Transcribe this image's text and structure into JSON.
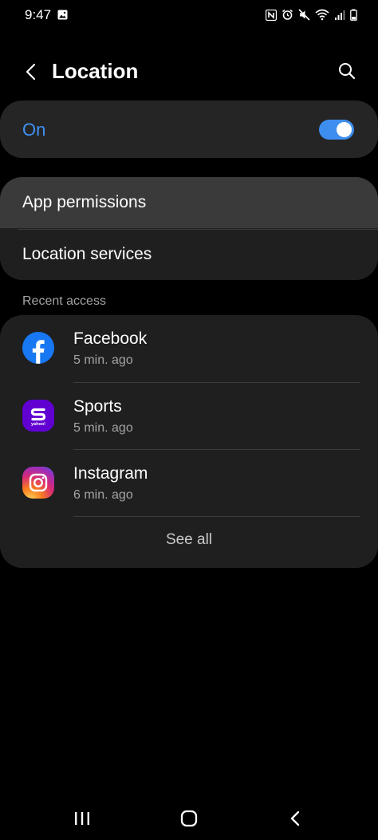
{
  "status_bar": {
    "time": "9:47",
    "left_icons": [
      "gallery-icon"
    ],
    "right_icons": [
      "nfc-icon",
      "alarm-icon",
      "mute-icon",
      "wifi-icon",
      "signal-icon",
      "battery-icon"
    ]
  },
  "header": {
    "title": "Location",
    "back_icon": "back-arrow-icon",
    "search_icon": "search-icon"
  },
  "master_toggle": {
    "label": "On",
    "state": true,
    "accent": "#3e91f4"
  },
  "settings": {
    "items": [
      {
        "label": "App permissions"
      },
      {
        "label": "Location services"
      }
    ]
  },
  "recent": {
    "header": "Recent access",
    "apps": [
      {
        "name": "Facebook",
        "time": "5 min. ago",
        "icon": "facebook-icon",
        "color": "#1877f2"
      },
      {
        "name": "Sports",
        "time": "5 min. ago",
        "icon": "yahoo-sports-icon",
        "color": "#6001d2",
        "icon_text": "yahoo!"
      },
      {
        "name": "Instagram",
        "time": "6 min. ago",
        "icon": "instagram-icon",
        "color": "#e1306c"
      }
    ],
    "see_all": "See all"
  },
  "nav_bar": {
    "buttons": [
      "recents-icon",
      "home-icon",
      "back-icon"
    ]
  }
}
